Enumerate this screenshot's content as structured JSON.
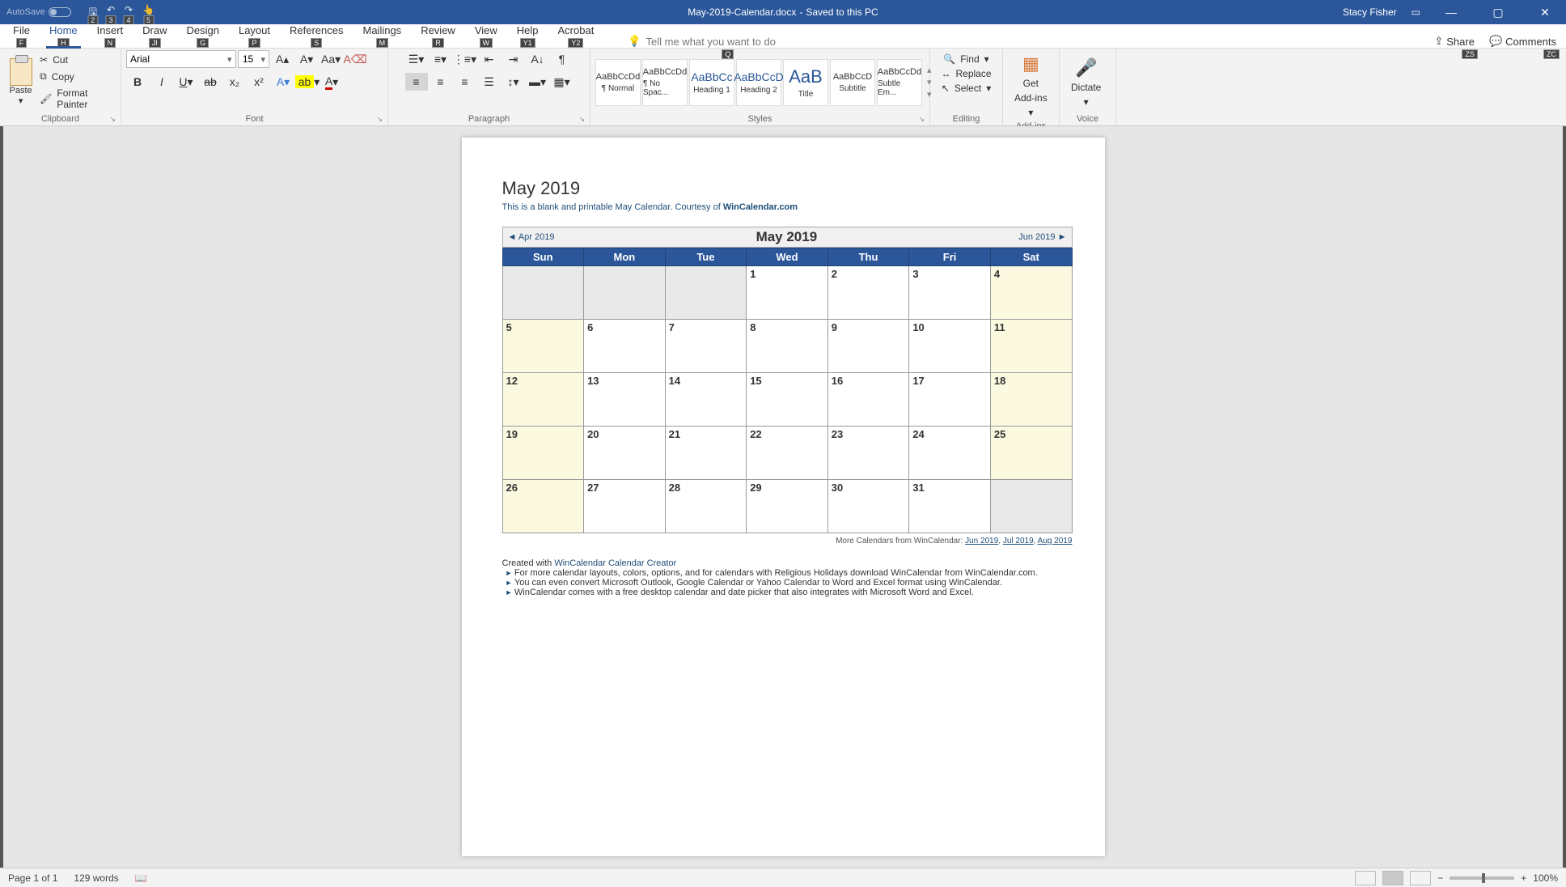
{
  "titlebar": {
    "autosave": "AutoSave",
    "filename": "May-2019-Calendar.docx",
    "saved_status": "Saved to this PC",
    "user": "Stacy Fisher",
    "qat_keytips": [
      "2",
      "3",
      "4",
      "5"
    ]
  },
  "tabs": {
    "items": [
      {
        "label": "File",
        "keytip": "F"
      },
      {
        "label": "Home",
        "keytip": "H"
      },
      {
        "label": "Insert",
        "keytip": "N"
      },
      {
        "label": "Draw",
        "keytip": "JI"
      },
      {
        "label": "Design",
        "keytip": "G"
      },
      {
        "label": "Layout",
        "keytip": "P"
      },
      {
        "label": "References",
        "keytip": "S"
      },
      {
        "label": "Mailings",
        "keytip": "M"
      },
      {
        "label": "Review",
        "keytip": "R"
      },
      {
        "label": "View",
        "keytip": "W"
      },
      {
        "label": "Help",
        "keytip": "Y1"
      },
      {
        "label": "Acrobat",
        "keytip": "Y2"
      }
    ],
    "tell_me": "Tell me what you want to do",
    "tell_me_keytip": "Q",
    "share": "Share",
    "share_keytip": "ZS",
    "comments": "Comments",
    "comments_keytip": "ZC"
  },
  "clipboard": {
    "paste": "Paste",
    "cut": "Cut",
    "copy": "Copy",
    "format_painter": "Format Painter",
    "group": "Clipboard"
  },
  "font": {
    "name": "Arial",
    "size": "15",
    "group": "Font"
  },
  "paragraph": {
    "group": "Paragraph"
  },
  "styles": {
    "group": "Styles",
    "items": [
      {
        "preview": "AaBbCcDd",
        "label": "¶ Normal"
      },
      {
        "preview": "AaBbCcDd",
        "label": "¶ No Spac..."
      },
      {
        "preview": "AaBbCc",
        "label": "Heading 1"
      },
      {
        "preview": "AaBbCcD",
        "label": "Heading 2"
      },
      {
        "preview": "AaB",
        "label": "Title"
      },
      {
        "preview": "AaBbCcD",
        "label": "Subtitle"
      },
      {
        "preview": "AaBbCcDd",
        "label": "Subtle Em..."
      }
    ]
  },
  "editing": {
    "find": "Find",
    "replace": "Replace",
    "select": "Select",
    "group": "Editing"
  },
  "addins": {
    "get": "Get",
    "addins": "Add-ins",
    "group": "Add-ins"
  },
  "voice": {
    "dictate": "Dictate",
    "group": "Voice"
  },
  "doc": {
    "title": "May 2019",
    "subtitle_a": "This is a blank and printable May Calendar.  Courtesy of ",
    "subtitle_link": "WinCalendar.com",
    "prev": "◄ Apr 2019",
    "cal_title": "May   2019",
    "next": "Jun 2019 ►",
    "days": [
      "Sun",
      "Mon",
      "Tue",
      "Wed",
      "Thu",
      "Fri",
      "Sat"
    ],
    "rows": [
      [
        "",
        "",
        "",
        "1",
        "2",
        "3",
        "4"
      ],
      [
        "5",
        "6",
        "7",
        "8",
        "9",
        "10",
        "11"
      ],
      [
        "12",
        "13",
        "14",
        "15",
        "16",
        "17",
        "18"
      ],
      [
        "19",
        "20",
        "21",
        "22",
        "23",
        "24",
        "25"
      ],
      [
        "26",
        "27",
        "28",
        "29",
        "30",
        "31",
        ""
      ]
    ],
    "more_label": "More Calendars from WinCalendar: ",
    "more_links": [
      "Jun 2019",
      "Jul 2019",
      "Aug 2019"
    ],
    "created": "Created with ",
    "created_link": "WinCalendar Calendar Creator",
    "bullets": [
      "For more calendar layouts, colors, options, and for calendars with Religious Holidays download WinCalendar from WinCalendar.com.",
      "You can even convert Microsoft Outlook, Google Calendar or Yahoo Calendar to Word and Excel format using WinCalendar.",
      "WinCalendar comes with a free desktop calendar and date picker that also integrates with Microsoft Word and Excel."
    ]
  },
  "status": {
    "page": "Page 1 of 1",
    "words": "129 words",
    "zoom": "100%"
  }
}
